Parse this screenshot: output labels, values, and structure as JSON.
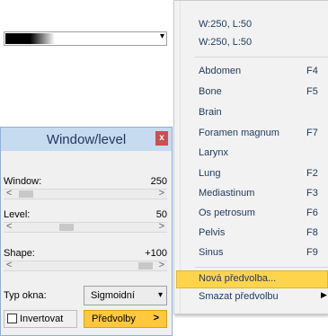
{
  "panel": {
    "title": "Window/level",
    "close_label": "x",
    "lut_arrow": "▾",
    "window_label": "Window:",
    "window_value": "250",
    "level_label": "Level:",
    "level_value": "50",
    "shape_label": "Shape:",
    "shape_value": "+100",
    "scroll_left": "<",
    "scroll_right": ">",
    "typ_label": "Typ okna:",
    "typ_value": "Sigmoidní",
    "typ_arrow": "▾",
    "invert_label": "Invertovat",
    "presets_label": "Předvolby",
    "presets_arrow": ">"
  },
  "menu": {
    "recent": [
      "W:250, L:50",
      "W:250, L:50"
    ],
    "presets": [
      {
        "label": "Abdomen",
        "shortcut": "F4"
      },
      {
        "label": "Bone",
        "shortcut": "F5"
      },
      {
        "label": "Brain",
        "shortcut": ""
      },
      {
        "label": "Foramen magnum",
        "shortcut": "F7"
      },
      {
        "label": "Larynx",
        "shortcut": ""
      },
      {
        "label": "Lung",
        "shortcut": "F2"
      },
      {
        "label": "Mediastinum",
        "shortcut": "F3"
      },
      {
        "label": "Os petrosum",
        "shortcut": "F6"
      },
      {
        "label": "Pelvis",
        "shortcut": "F8"
      },
      {
        "label": "Sinus",
        "shortcut": "F9"
      }
    ],
    "new_preset": "Nová předvolba...",
    "delete_preset": "Smazat předvolbu",
    "submenu_arrow": "▶"
  },
  "colors": {
    "accent": "#ffc83d",
    "title_text": "#1e395b",
    "menu_text": "#1e395b",
    "close_button": "#c75050"
  }
}
